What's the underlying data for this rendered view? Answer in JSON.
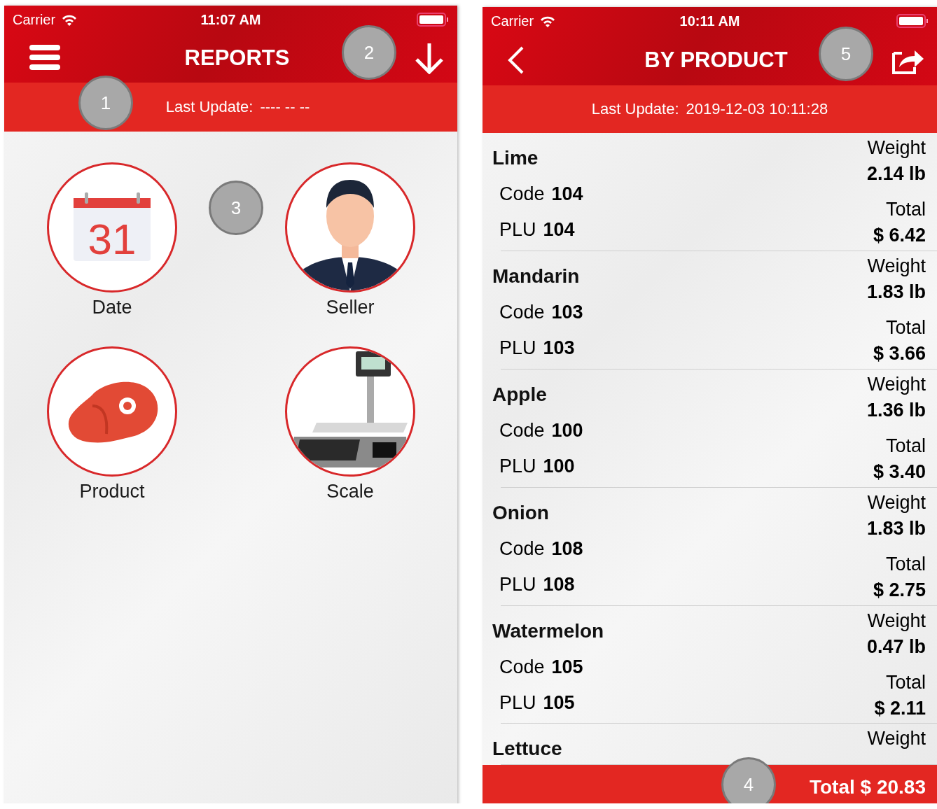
{
  "screens": [
    {
      "kind": "menu",
      "status_bar": {
        "carrier": "Carrier",
        "time": "11:07 AM"
      },
      "nav": {
        "title": "REPORTS"
      },
      "last_update": {
        "label": "Last Update:",
        "value": "---- -- --"
      },
      "tiles": [
        {
          "kind": "date",
          "label": "Date",
          "day": "31"
        },
        {
          "kind": "seller",
          "label": "Seller"
        },
        {
          "kind": "product",
          "label": "Product"
        },
        {
          "kind": "scale",
          "label": "Scale"
        }
      ],
      "callouts": [
        {
          "number": "1"
        },
        {
          "number": "2"
        },
        {
          "number": "3"
        }
      ]
    },
    {
      "kind": "list",
      "status_bar": {
        "carrier": "Carrier",
        "time": "10:11 AM"
      },
      "nav": {
        "title": "BY PRODUCT"
      },
      "last_update": {
        "label": "Last Update:",
        "value": "2019-12-03 10:11:28"
      },
      "products": [
        {
          "name": "Lime",
          "code_label": "Code",
          "code": "104",
          "plu_label": "PLU",
          "plu": "104",
          "weight_label": "Weight",
          "weight": "2.14 lb",
          "total_label": "Total",
          "total": "$ 6.42"
        },
        {
          "name": "Mandarin",
          "code_label": "Code",
          "code": "103",
          "plu_label": "PLU",
          "plu": "103",
          "weight_label": "Weight",
          "weight": "1.83 lb",
          "total_label": "Total",
          "total": "$ 3.66"
        },
        {
          "name": "Apple",
          "code_label": "Code",
          "code": "100",
          "plu_label": "PLU",
          "plu": "100",
          "weight_label": "Weight",
          "weight": "1.36 lb",
          "total_label": "Total",
          "total": "$ 3.40"
        },
        {
          "name": "Onion",
          "code_label": "Code",
          "code": "108",
          "plu_label": "PLU",
          "plu": "108",
          "weight_label": "Weight",
          "weight": "1.83 lb",
          "total_label": "Total",
          "total": "$ 2.75"
        },
        {
          "name": "Watermelon",
          "code_label": "Code",
          "code": "105",
          "plu_label": "PLU",
          "plu": "105",
          "weight_label": "Weight",
          "weight": "0.47 lb",
          "total_label": "Total",
          "total": "$ 2.11"
        },
        {
          "name": "Lettuce",
          "weight_label": "Weight"
        }
      ],
      "footer": {
        "total": "Total $ 20.83"
      },
      "callouts": [
        {
          "number": "5"
        },
        {
          "number": "4"
        }
      ]
    }
  ]
}
